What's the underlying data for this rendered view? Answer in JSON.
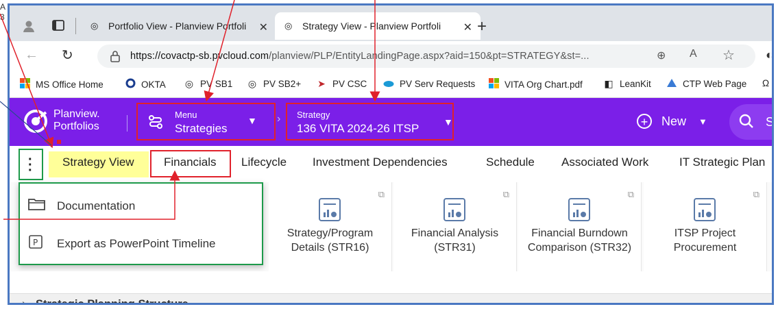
{
  "margin_notes": [
    "A",
    "3"
  ],
  "browser": {
    "tabs": [
      {
        "title": "Portfolio View - Planview Portfoli",
        "active": false
      },
      {
        "title": "Strategy View - Planview Portfoli",
        "active": true
      }
    ],
    "url_host": "https://covactp-sb.pvcloud.com",
    "url_rest": "/planview/PLP/EntityLandingPage.aspx?aid=150&pt=STRATEGY&st=...",
    "bookmarks": [
      "MS Office Home",
      "OKTA",
      "PV SB1",
      "PV SB2+",
      "PV CSC",
      "PV Serv Requests",
      "VITA Org Chart.pdf",
      "LeanKit",
      "CTP Web Page"
    ]
  },
  "app": {
    "brand_line1": "Planview.",
    "brand_line2": "Portfolios",
    "menu_label": "Menu",
    "menu_value": "Strategies",
    "context_label": "Strategy",
    "context_value": "136 VITA 2024-26 ITSP",
    "new_label": "New",
    "search_partial": "S",
    "accent": "#7b1fe8"
  },
  "page_tabs": [
    "Strategy View",
    "Financials",
    "Lifecycle",
    "Investment Dependencies",
    "Schedule",
    "Associated Work",
    "IT Strategic Plan"
  ],
  "overflow_menu": {
    "items": [
      "Documentation",
      "Export as PowerPoint Timeline"
    ]
  },
  "tiles": [
    "Strategy/Program Details (STR16)",
    "Financial Analysis (STR31)",
    "Financial Burndown Comparison (STR32)",
    "ITSP Project Procurement"
  ],
  "section_title": "Strategic Planning Structure",
  "annotation_colors": {
    "red": "#e0212b",
    "green": "#1d9a4a",
    "highlight": "#ffff99"
  }
}
